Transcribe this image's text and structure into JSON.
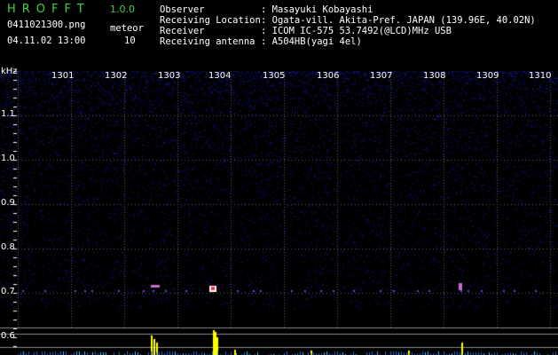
{
  "app": {
    "name": "HROFFT",
    "version": "1.0.0"
  },
  "file": {
    "name": "0411021300.png",
    "datetime": "04.11.02 13:00"
  },
  "meteor": {
    "label": "meteor",
    "count": "10"
  },
  "info": [
    {
      "label": "Observer",
      "value": ": Masayuki Kobayashi"
    },
    {
      "label": "Receiving Location",
      "value": ": Ogata-vill. Akita-Pref. JAPAN (139.96E, 40.02N)"
    },
    {
      "label": "Receiver",
      "value": ": ICOM IC-575 53.7492(@LCD)MHz USB"
    },
    {
      "label": "Receiving antenna",
      "value": ": A504HB(yagi 4el)"
    }
  ],
  "spectrogram": {
    "unit": "kHz",
    "time_ticks": [
      "1301",
      "1302",
      "1303",
      "1304",
      "1305",
      "1306",
      "1307",
      "1308",
      "1309",
      "1310"
    ],
    "freq_ticks": [
      "1.1",
      "1.0",
      "0.9",
      "0.8",
      "0.7",
      "0.6"
    ],
    "colors": {
      "background": "#000000",
      "noise": "#1a1aa0",
      "grid": "#5a5a5a",
      "signal": "#ffff00"
    }
  }
}
